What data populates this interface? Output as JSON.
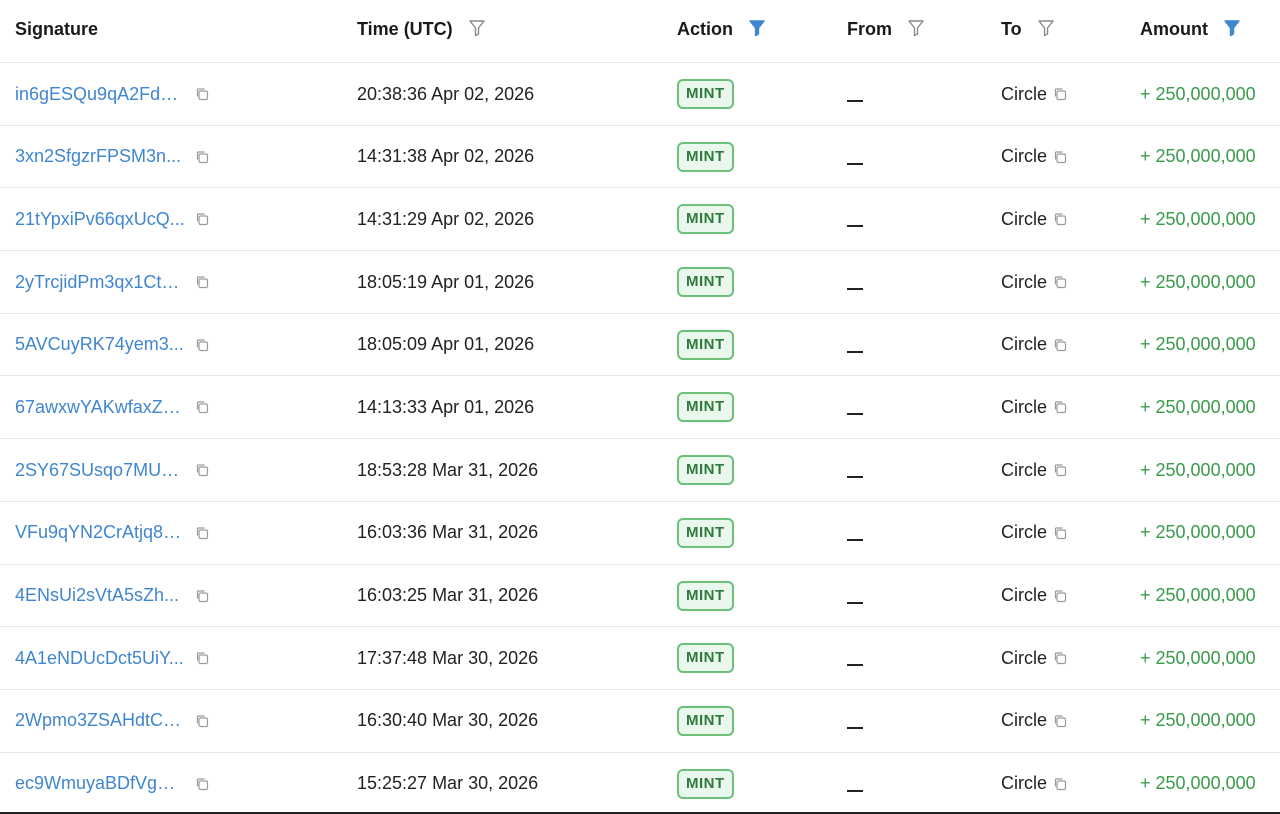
{
  "columns": {
    "signature": "Signature",
    "time": "Time (UTC)",
    "action": "Action",
    "from": "From",
    "to": "To",
    "amount": "Amount"
  },
  "filter_colors": {
    "inactive": "#9a9a9a",
    "active": "#3f86cf"
  },
  "rows": [
    {
      "signature": "in6gESQu9qA2Fd9...",
      "time": "20:38:36 Apr 02, 2026",
      "action": "MINT",
      "from": "",
      "to": "Circle",
      "amount": "+ 250,000,000"
    },
    {
      "signature": "3xn2SfgzrFPSM3n...",
      "time": "14:31:38 Apr 02, 2026",
      "action": "MINT",
      "from": "",
      "to": "Circle",
      "amount": "+ 250,000,000"
    },
    {
      "signature": "21tYpxiPv66qxUcQ...",
      "time": "14:31:29 Apr 02, 2026",
      "action": "MINT",
      "from": "",
      "to": "Circle",
      "amount": "+ 250,000,000"
    },
    {
      "signature": "2yTrcjidPm3qx1Ctp...",
      "time": "18:05:19 Apr 01, 2026",
      "action": "MINT",
      "from": "",
      "to": "Circle",
      "amount": "+ 250,000,000"
    },
    {
      "signature": "5AVCuyRK74yem3...",
      "time": "18:05:09 Apr 01, 2026",
      "action": "MINT",
      "from": "",
      "to": "Circle",
      "amount": "+ 250,000,000"
    },
    {
      "signature": "67awxwYAKwfaxZu...",
      "time": "14:13:33 Apr 01, 2026",
      "action": "MINT",
      "from": "",
      "to": "Circle",
      "amount": "+ 250,000,000"
    },
    {
      "signature": "2SY67SUsqo7MUp...",
      "time": "18:53:28 Mar 31, 2026",
      "action": "MINT",
      "from": "",
      "to": "Circle",
      "amount": "+ 250,000,000"
    },
    {
      "signature": "VFu9qYN2CrAtjq8d...",
      "time": "16:03:36 Mar 31, 2026",
      "action": "MINT",
      "from": "",
      "to": "Circle",
      "amount": "+ 250,000,000"
    },
    {
      "signature": "4ENsUi2sVtA5sZh...",
      "time": "16:03:25 Mar 31, 2026",
      "action": "MINT",
      "from": "",
      "to": "Circle",
      "amount": "+ 250,000,000"
    },
    {
      "signature": "4A1eNDUcDct5UiY...",
      "time": "17:37:48 Mar 30, 2026",
      "action": "MINT",
      "from": "",
      "to": "Circle",
      "amount": "+ 250,000,000"
    },
    {
      "signature": "2Wpmo3ZSAHdtCs...",
      "time": "16:30:40 Mar 30, 2026",
      "action": "MINT",
      "from": "",
      "to": "Circle",
      "amount": "+ 250,000,000"
    },
    {
      "signature": "ec9WmuyaBDfVgG...",
      "time": "15:25:27 Mar 30, 2026",
      "action": "MINT",
      "from": "",
      "to": "Circle",
      "amount": "+ 250,000,000"
    }
  ]
}
